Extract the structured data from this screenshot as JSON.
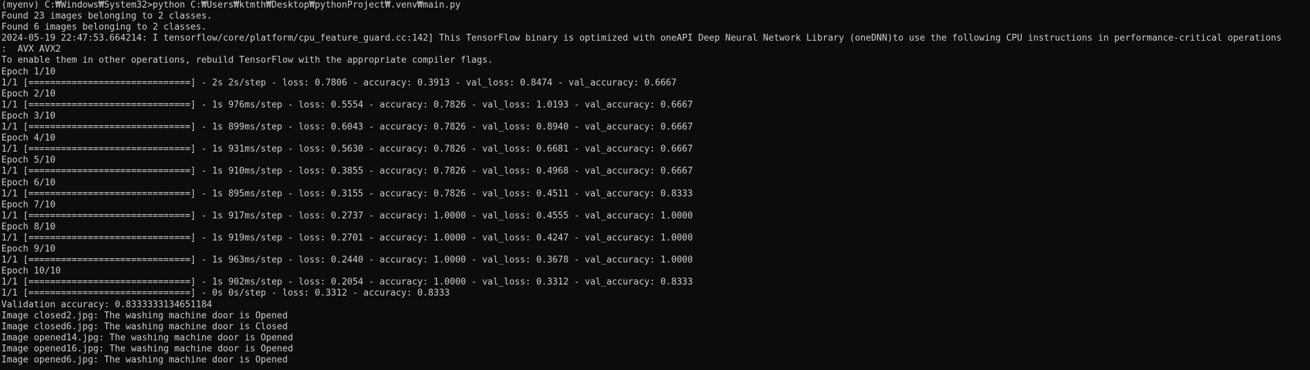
{
  "terminal": {
    "text_color": "#cccccc",
    "background": "#0c0c0c",
    "lines": [
      "(myenv) C:₩Windows₩System32>python C:₩Users₩ktmth₩Desktop₩pythonProject₩.venv₩main.py",
      "Found 23 images belonging to 2 classes.",
      "Found 6 images belonging to 2 classes.",
      "2024-05-19 22:47:53.664214: I tensorflow/core/platform/cpu_feature_guard.cc:142] This TensorFlow binary is optimized with oneAPI Deep Neural Network Library (oneDNN)to use the following CPU instructions in performance-critical operations",
      ":  AVX AVX2",
      "To enable them in other operations, rebuild TensorFlow with the appropriate compiler flags.",
      "Epoch 1/10",
      "1/1 [==============================] - 2s 2s/step - loss: 0.7806 - accuracy: 0.3913 - val_loss: 0.8474 - val_accuracy: 0.6667",
      "Epoch 2/10",
      "1/1 [==============================] - 1s 976ms/step - loss: 0.5554 - accuracy: 0.7826 - val_loss: 1.0193 - val_accuracy: 0.6667",
      "Epoch 3/10",
      "1/1 [==============================] - 1s 899ms/step - loss: 0.6043 - accuracy: 0.7826 - val_loss: 0.8940 - val_accuracy: 0.6667",
      "Epoch 4/10",
      "1/1 [==============================] - 1s 931ms/step - loss: 0.5630 - accuracy: 0.7826 - val_loss: 0.6681 - val_accuracy: 0.6667",
      "Epoch 5/10",
      "1/1 [==============================] - 1s 910ms/step - loss: 0.3855 - accuracy: 0.7826 - val_loss: 0.4968 - val_accuracy: 0.6667",
      "Epoch 6/10",
      "1/1 [==============================] - 1s 895ms/step - loss: 0.3155 - accuracy: 0.7826 - val_loss: 0.4511 - val_accuracy: 0.8333",
      "Epoch 7/10",
      "1/1 [==============================] - 1s 917ms/step - loss: 0.2737 - accuracy: 1.0000 - val_loss: 0.4555 - val_accuracy: 1.0000",
      "Epoch 8/10",
      "1/1 [==============================] - 1s 919ms/step - loss: 0.2701 - accuracy: 1.0000 - val_loss: 0.4247 - val_accuracy: 1.0000",
      "Epoch 9/10",
      "1/1 [==============================] - 1s 963ms/step - loss: 0.2440 - accuracy: 1.0000 - val_loss: 0.3678 - val_accuracy: 1.0000",
      "Epoch 10/10",
      "1/1 [==============================] - 1s 902ms/step - loss: 0.2054 - accuracy: 1.0000 - val_loss: 0.3312 - val_accuracy: 0.8333",
      "1/1 [==============================] - 0s 0s/step - loss: 0.3312 - accuracy: 0.8333",
      "Validation accuracy: 0.8333333134651184",
      "Image closed2.jpg: The washing machine door is Opened",
      "Image closed6.jpg: The washing machine door is Closed",
      "Image opened14.jpg: The washing machine door is Opened",
      "Image opened16.jpg: The washing machine door is Opened",
      "Image opened6.jpg: The washing machine door is Opened"
    ]
  }
}
